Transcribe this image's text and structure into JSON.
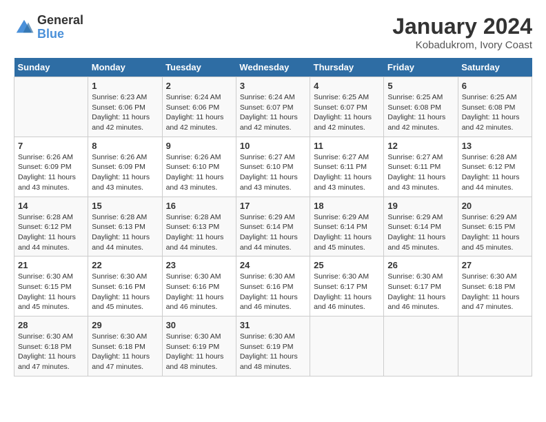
{
  "logo": {
    "text_general": "General",
    "text_blue": "Blue"
  },
  "title": "January 2024",
  "subtitle": "Kobadukrom, Ivory Coast",
  "days_header": [
    "Sunday",
    "Monday",
    "Tuesday",
    "Wednesday",
    "Thursday",
    "Friday",
    "Saturday"
  ],
  "weeks": [
    [
      {
        "day": "",
        "sunrise": "",
        "sunset": "",
        "daylight": ""
      },
      {
        "day": "1",
        "sunrise": "Sunrise: 6:23 AM",
        "sunset": "Sunset: 6:06 PM",
        "daylight": "Daylight: 11 hours and 42 minutes."
      },
      {
        "day": "2",
        "sunrise": "Sunrise: 6:24 AM",
        "sunset": "Sunset: 6:06 PM",
        "daylight": "Daylight: 11 hours and 42 minutes."
      },
      {
        "day": "3",
        "sunrise": "Sunrise: 6:24 AM",
        "sunset": "Sunset: 6:07 PM",
        "daylight": "Daylight: 11 hours and 42 minutes."
      },
      {
        "day": "4",
        "sunrise": "Sunrise: 6:25 AM",
        "sunset": "Sunset: 6:07 PM",
        "daylight": "Daylight: 11 hours and 42 minutes."
      },
      {
        "day": "5",
        "sunrise": "Sunrise: 6:25 AM",
        "sunset": "Sunset: 6:08 PM",
        "daylight": "Daylight: 11 hours and 42 minutes."
      },
      {
        "day": "6",
        "sunrise": "Sunrise: 6:25 AM",
        "sunset": "Sunset: 6:08 PM",
        "daylight": "Daylight: 11 hours and 42 minutes."
      }
    ],
    [
      {
        "day": "7",
        "sunrise": "Sunrise: 6:26 AM",
        "sunset": "Sunset: 6:09 PM",
        "daylight": "Daylight: 11 hours and 43 minutes."
      },
      {
        "day": "8",
        "sunrise": "Sunrise: 6:26 AM",
        "sunset": "Sunset: 6:09 PM",
        "daylight": "Daylight: 11 hours and 43 minutes."
      },
      {
        "day": "9",
        "sunrise": "Sunrise: 6:26 AM",
        "sunset": "Sunset: 6:10 PM",
        "daylight": "Daylight: 11 hours and 43 minutes."
      },
      {
        "day": "10",
        "sunrise": "Sunrise: 6:27 AM",
        "sunset": "Sunset: 6:10 PM",
        "daylight": "Daylight: 11 hours and 43 minutes."
      },
      {
        "day": "11",
        "sunrise": "Sunrise: 6:27 AM",
        "sunset": "Sunset: 6:11 PM",
        "daylight": "Daylight: 11 hours and 43 minutes."
      },
      {
        "day": "12",
        "sunrise": "Sunrise: 6:27 AM",
        "sunset": "Sunset: 6:11 PM",
        "daylight": "Daylight: 11 hours and 43 minutes."
      },
      {
        "day": "13",
        "sunrise": "Sunrise: 6:28 AM",
        "sunset": "Sunset: 6:12 PM",
        "daylight": "Daylight: 11 hours and 44 minutes."
      }
    ],
    [
      {
        "day": "14",
        "sunrise": "Sunrise: 6:28 AM",
        "sunset": "Sunset: 6:12 PM",
        "daylight": "Daylight: 11 hours and 44 minutes."
      },
      {
        "day": "15",
        "sunrise": "Sunrise: 6:28 AM",
        "sunset": "Sunset: 6:13 PM",
        "daylight": "Daylight: 11 hours and 44 minutes."
      },
      {
        "day": "16",
        "sunrise": "Sunrise: 6:28 AM",
        "sunset": "Sunset: 6:13 PM",
        "daylight": "Daylight: 11 hours and 44 minutes."
      },
      {
        "day": "17",
        "sunrise": "Sunrise: 6:29 AM",
        "sunset": "Sunset: 6:14 PM",
        "daylight": "Daylight: 11 hours and 44 minutes."
      },
      {
        "day": "18",
        "sunrise": "Sunrise: 6:29 AM",
        "sunset": "Sunset: 6:14 PM",
        "daylight": "Daylight: 11 hours and 45 minutes."
      },
      {
        "day": "19",
        "sunrise": "Sunrise: 6:29 AM",
        "sunset": "Sunset: 6:14 PM",
        "daylight": "Daylight: 11 hours and 45 minutes."
      },
      {
        "day": "20",
        "sunrise": "Sunrise: 6:29 AM",
        "sunset": "Sunset: 6:15 PM",
        "daylight": "Daylight: 11 hours and 45 minutes."
      }
    ],
    [
      {
        "day": "21",
        "sunrise": "Sunrise: 6:30 AM",
        "sunset": "Sunset: 6:15 PM",
        "daylight": "Daylight: 11 hours and 45 minutes."
      },
      {
        "day": "22",
        "sunrise": "Sunrise: 6:30 AM",
        "sunset": "Sunset: 6:16 PM",
        "daylight": "Daylight: 11 hours and 45 minutes."
      },
      {
        "day": "23",
        "sunrise": "Sunrise: 6:30 AM",
        "sunset": "Sunset: 6:16 PM",
        "daylight": "Daylight: 11 hours and 46 minutes."
      },
      {
        "day": "24",
        "sunrise": "Sunrise: 6:30 AM",
        "sunset": "Sunset: 6:16 PM",
        "daylight": "Daylight: 11 hours and 46 minutes."
      },
      {
        "day": "25",
        "sunrise": "Sunrise: 6:30 AM",
        "sunset": "Sunset: 6:17 PM",
        "daylight": "Daylight: 11 hours and 46 minutes."
      },
      {
        "day": "26",
        "sunrise": "Sunrise: 6:30 AM",
        "sunset": "Sunset: 6:17 PM",
        "daylight": "Daylight: 11 hours and 46 minutes."
      },
      {
        "day": "27",
        "sunrise": "Sunrise: 6:30 AM",
        "sunset": "Sunset: 6:18 PM",
        "daylight": "Daylight: 11 hours and 47 minutes."
      }
    ],
    [
      {
        "day": "28",
        "sunrise": "Sunrise: 6:30 AM",
        "sunset": "Sunset: 6:18 PM",
        "daylight": "Daylight: 11 hours and 47 minutes."
      },
      {
        "day": "29",
        "sunrise": "Sunrise: 6:30 AM",
        "sunset": "Sunset: 6:18 PM",
        "daylight": "Daylight: 11 hours and 47 minutes."
      },
      {
        "day": "30",
        "sunrise": "Sunrise: 6:30 AM",
        "sunset": "Sunset: 6:19 PM",
        "daylight": "Daylight: 11 hours and 48 minutes."
      },
      {
        "day": "31",
        "sunrise": "Sunrise: 6:30 AM",
        "sunset": "Sunset: 6:19 PM",
        "daylight": "Daylight: 11 hours and 48 minutes."
      },
      {
        "day": "",
        "sunrise": "",
        "sunset": "",
        "daylight": ""
      },
      {
        "day": "",
        "sunrise": "",
        "sunset": "",
        "daylight": ""
      },
      {
        "day": "",
        "sunrise": "",
        "sunset": "",
        "daylight": ""
      }
    ]
  ]
}
